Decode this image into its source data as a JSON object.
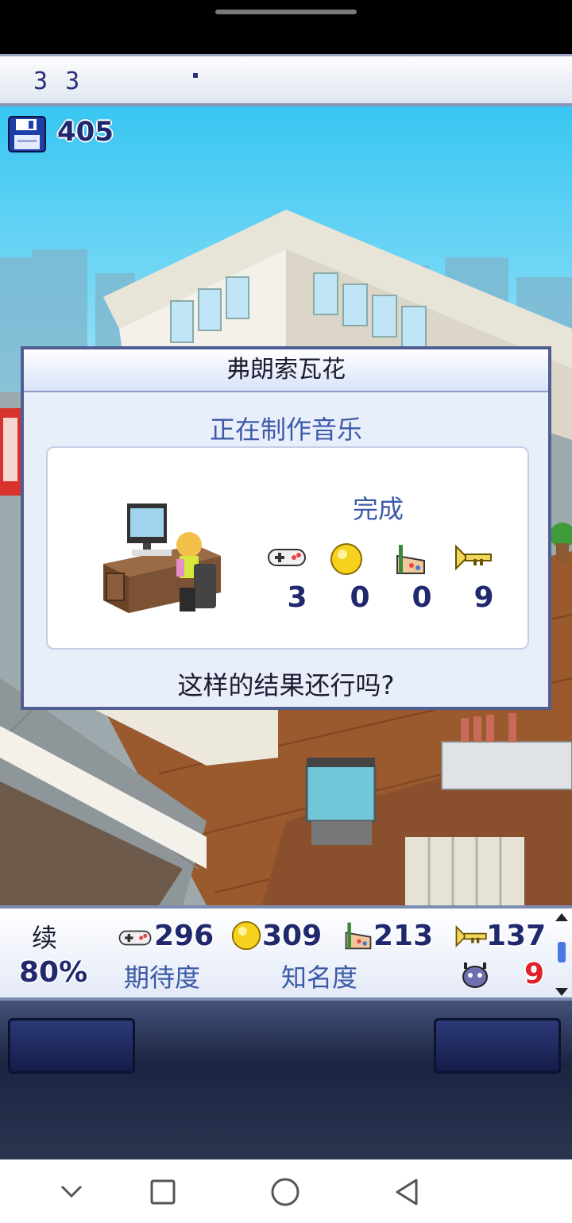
{
  "topbar": {
    "date": "3 3"
  },
  "scene": {
    "save_count": "405"
  },
  "dialog": {
    "title": "弗朗索瓦花",
    "subtitle": "正在制作音乐",
    "result_label": "完成",
    "stats": [
      {
        "icon": "gamepad-icon",
        "value": "3"
      },
      {
        "icon": "coin-icon",
        "value": "0"
      },
      {
        "icon": "paint-palette-icon",
        "value": "0"
      },
      {
        "icon": "trumpet-icon",
        "value": "9"
      }
    ],
    "question": "这样的结果还行吗?"
  },
  "bottom": {
    "continue_label": "续",
    "continue_percent": "80%",
    "expectation_label": "期待度",
    "fame_label": "知名度",
    "stats": [
      {
        "icon": "gamepad-icon",
        "value": "296"
      },
      {
        "icon": "coin-icon",
        "value": "309"
      },
      {
        "icon": "paint-palette-icon",
        "value": "213"
      },
      {
        "icon": "trumpet-icon",
        "value": "137"
      }
    ],
    "bug_count": "9"
  },
  "colors": {
    "accent": "#3b5aa8",
    "number": "#20286e",
    "bug": "#e0202a"
  }
}
